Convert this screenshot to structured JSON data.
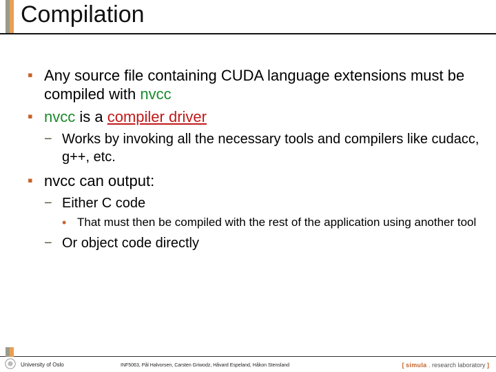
{
  "title": "Compilation",
  "bullets": {
    "b1a": "Any source file containing CUDA language extensions must be compiled with ",
    "b1_nvcc": "nvcc",
    "b2a": "nvcc",
    "b2b": " is a ",
    "b2c": "compiler driver",
    "b2_sub1": "Works by invoking all the necessary tools and compilers like cudacc, g++, etc.",
    "b3": "nvcc can output:",
    "b3_sub1": "Either C code",
    "b3_sub1_sub1": "That must then be compiled with the rest of the application using another tool",
    "b3_sub2": "Or object code directly"
  },
  "footer": {
    "uio": "University of Oslo",
    "credits": "INF5063, Pål Halvorsen, Carsten Griwodz, Håvard Espeland, Håkon Stensland",
    "brL": "[ ",
    "sim": "simula",
    "dot": " . ",
    "lab": "research laboratory",
    "brR": " ]"
  }
}
